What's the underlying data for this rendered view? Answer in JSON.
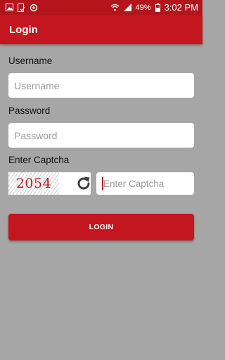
{
  "status_bar": {
    "battery": "49%",
    "time": "3:02 PM",
    "icons_left": [
      "gallery-icon",
      "file-check-icon",
      "sync-icon"
    ],
    "icons_right": [
      "wifi-icon",
      "signal-icon",
      "battery-icon"
    ]
  },
  "app_bar": {
    "title": "Login"
  },
  "form": {
    "username_label": "Username",
    "username_placeholder": "Username",
    "password_label": "Password",
    "password_placeholder": "Password",
    "captcha_label": "Enter Captcha",
    "captcha_code": "2054",
    "captcha_placeholder": "Enter Captcha",
    "login_button": "LOGIN"
  },
  "colors": {
    "primary": "#c4161f",
    "status_bar": "#b4151d",
    "background": "#a6a6a6"
  }
}
